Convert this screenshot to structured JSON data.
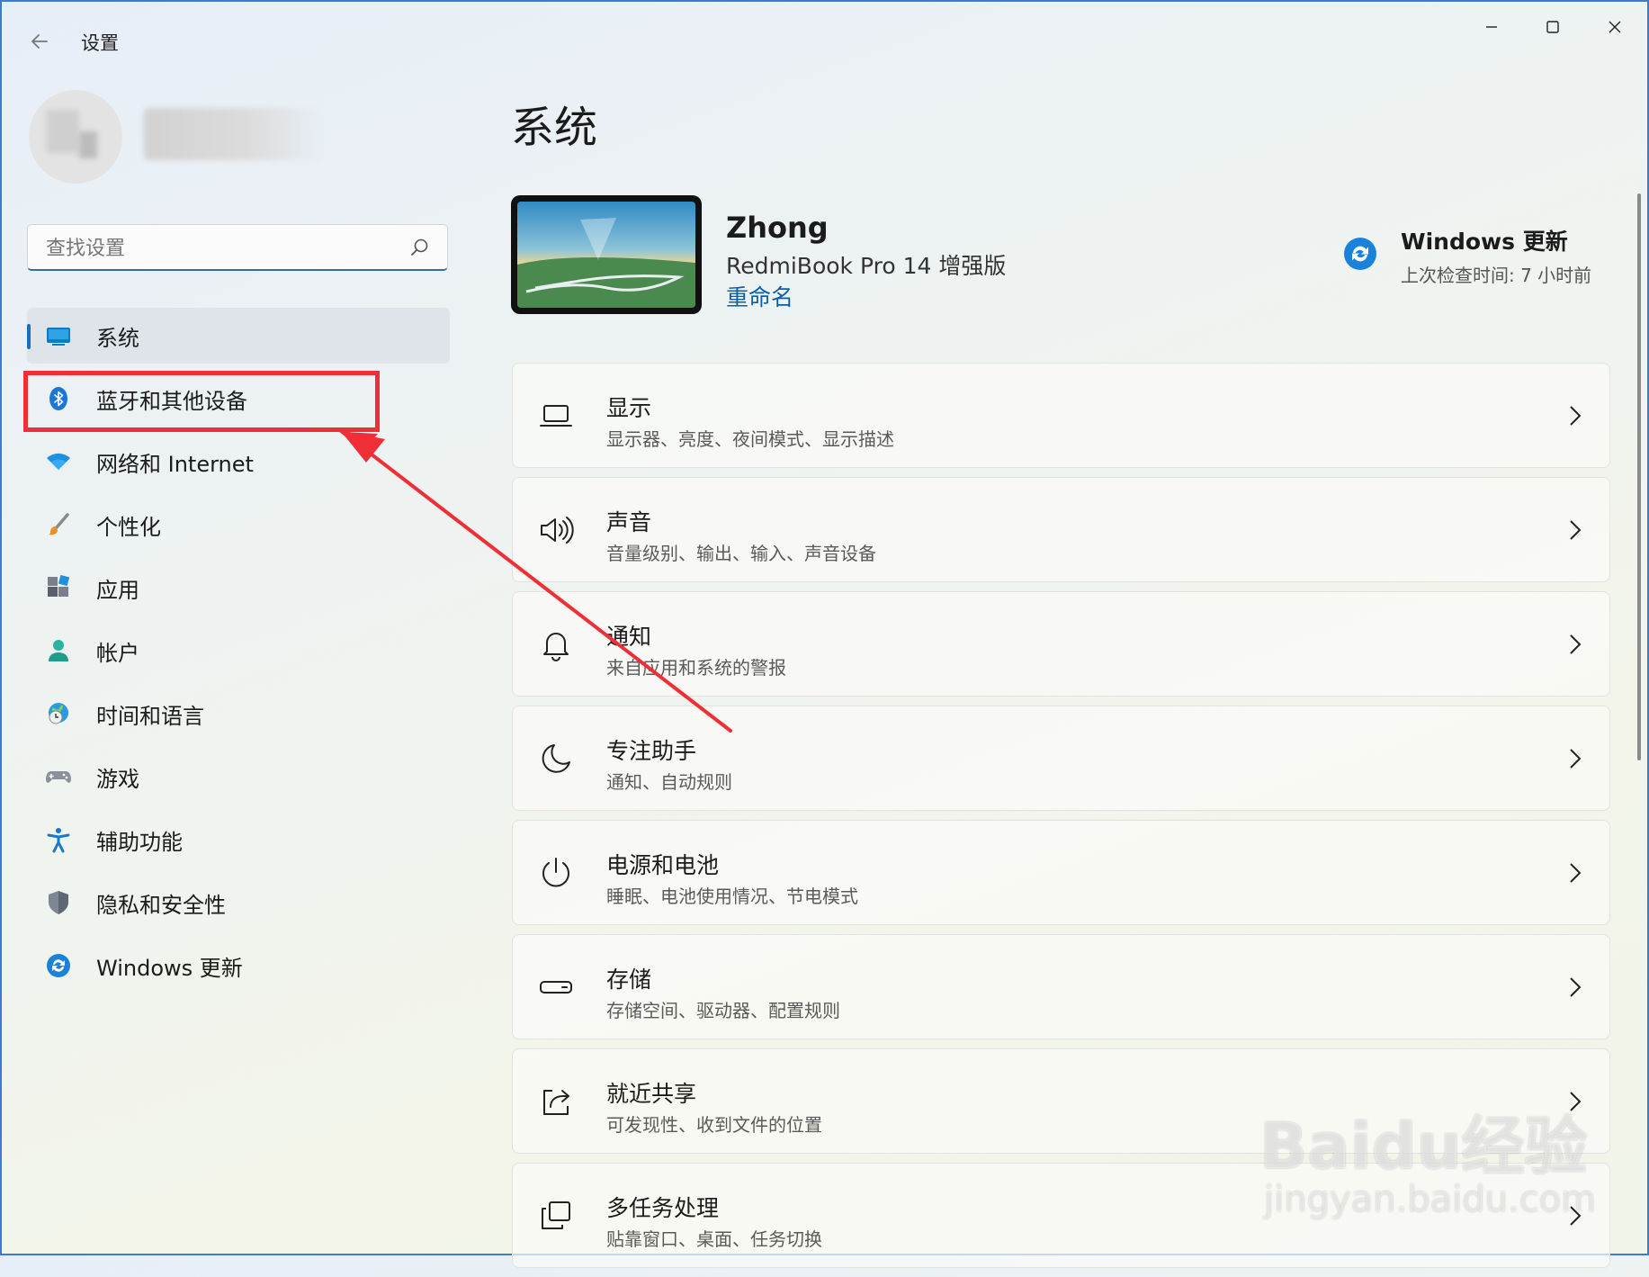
{
  "window": {
    "title": "设置",
    "back_icon": "back-arrow-icon",
    "minimize_glyph": "—",
    "maximize_glyph": "☐",
    "close_glyph": "✕"
  },
  "sidebar": {
    "search": {
      "placeholder": "查找设置",
      "value": ""
    },
    "items": [
      {
        "label": "系统",
        "icon": "monitor-icon",
        "selected": true
      },
      {
        "label": "蓝牙和其他设备",
        "icon": "bluetooth-icon",
        "selected": false
      },
      {
        "label": "网络和 Internet",
        "icon": "wifi-icon",
        "selected": false
      },
      {
        "label": "个性化",
        "icon": "paintbrush-icon",
        "selected": false
      },
      {
        "label": "应用",
        "icon": "apps-icon",
        "selected": false
      },
      {
        "label": "帐户",
        "icon": "account-icon",
        "selected": false
      },
      {
        "label": "时间和语言",
        "icon": "globe-clock-icon",
        "selected": false
      },
      {
        "label": "游戏",
        "icon": "gamepad-icon",
        "selected": false
      },
      {
        "label": "辅助功能",
        "icon": "accessibility-icon",
        "selected": false
      },
      {
        "label": "隐私和安全性",
        "icon": "shield-icon",
        "selected": false
      },
      {
        "label": "Windows 更新",
        "icon": "windows-update-icon",
        "selected": false
      }
    ]
  },
  "main": {
    "title": "系统",
    "device": {
      "name": "Zhong",
      "model": "RedmiBook Pro 14 增强版",
      "rename_label": "重命名"
    },
    "windows_update": {
      "title": "Windows 更新",
      "subtitle": "上次检查时间: 7 小时前"
    },
    "cards": [
      {
        "title": "显示",
        "subtitle": "显示器、亮度、夜间模式、显示描述",
        "icon": "laptop-icon"
      },
      {
        "title": "声音",
        "subtitle": "音量级别、输出、输入、声音设备",
        "icon": "speaker-icon"
      },
      {
        "title": "通知",
        "subtitle": "来自应用和系统的警报",
        "icon": "bell-icon"
      },
      {
        "title": "专注助手",
        "subtitle": "通知、自动规则",
        "icon": "moon-icon"
      },
      {
        "title": "电源和电池",
        "subtitle": "睡眠、电池使用情况、节电模式",
        "icon": "power-icon"
      },
      {
        "title": "存储",
        "subtitle": "存储空间、驱动器、配置规则",
        "icon": "storage-drive-icon"
      },
      {
        "title": "就近共享",
        "subtitle": "可发现性、收到文件的位置",
        "icon": "share-icon"
      },
      {
        "title": "多任务处理",
        "subtitle": "贴靠窗口、桌面、任务切换",
        "icon": "multitask-icon"
      }
    ]
  },
  "watermark": {
    "text": "Baidu经验",
    "url_text": "jingyan.baidu.com"
  },
  "colors": {
    "accent": "#1a6fc2",
    "highlight_red": "#ee2f36",
    "link": "#0a5fa8"
  }
}
